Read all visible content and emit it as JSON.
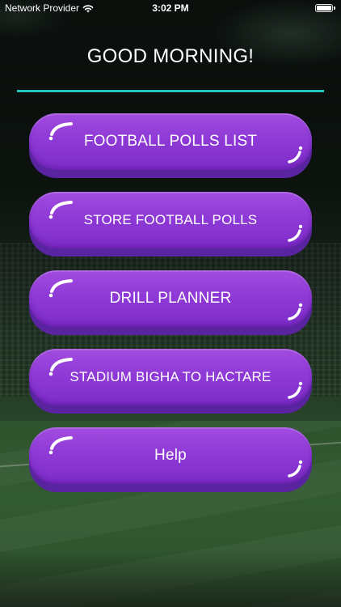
{
  "status_bar": {
    "carrier": "Network Provider",
    "time": "3:02 PM"
  },
  "header": {
    "greeting": "GOOD MORNING!"
  },
  "menu": {
    "items": [
      {
        "label": "FOOTBALL POLLS LIST"
      },
      {
        "label": "STORE FOOTBALL POLLS"
      },
      {
        "label": "DRILL PLANNER"
      },
      {
        "label": "STADIUM BIGHA TO HACTARE"
      },
      {
        "label": "Help"
      }
    ]
  },
  "colors": {
    "accent_line": "#22c6c0",
    "button_top": "#a24ce0",
    "button_bottom": "#7e2cc8",
    "button_edge": "#5a23a0"
  }
}
